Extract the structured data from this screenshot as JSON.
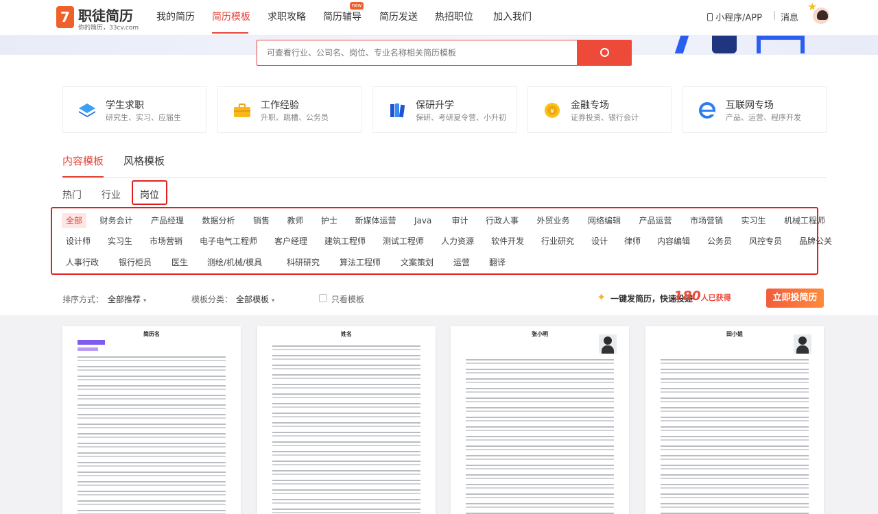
{
  "header": {
    "logo_mark": "7",
    "logo_name": "职徒简历",
    "logo_sub": "你的简历，33cv.com",
    "nav": [
      {
        "label": "我的简历",
        "active": false
      },
      {
        "label": "简历模板",
        "active": true
      },
      {
        "label": "求职攻略",
        "active": false
      },
      {
        "label": "简历辅导",
        "active": false,
        "badge": "new"
      },
      {
        "label": "简历发送",
        "active": false
      },
      {
        "label": "热招职位",
        "active": false
      },
      {
        "label": "加入我们",
        "active": false
      }
    ],
    "mini_app": "小程序/APP",
    "separator": "|",
    "messages": "消息"
  },
  "search": {
    "placeholder": "可查看行业、公司名、岗位、专业名称相关简历模板"
  },
  "categories": [
    {
      "title": "学生求职",
      "subtitle": "研究生、实习、应届生",
      "icon": "layers-icon"
    },
    {
      "title": "工作经验",
      "subtitle": "升职、跳槽、公务员",
      "icon": "briefcase-icon"
    },
    {
      "title": "保研升学",
      "subtitle": "保研、考研夏令营、小升初",
      "icon": "books-icon"
    },
    {
      "title": "金融专场",
      "subtitle": "证券投资、银行会计",
      "icon": "coin-icon"
    },
    {
      "title": "互联网专场",
      "subtitle": "产品、运营、程序开发",
      "icon": "browser-icon"
    }
  ],
  "template_tabs": [
    {
      "label": "内容模板",
      "active": true
    },
    {
      "label": "风格模板",
      "active": false
    }
  ],
  "sub_tabs": [
    {
      "label": "热门",
      "active": false
    },
    {
      "label": "行业",
      "active": false
    },
    {
      "label": "岗位",
      "active": true
    }
  ],
  "positions": [
    [
      "全部",
      "财务会计",
      "产品经理",
      "数据分析",
      "销售",
      "教师",
      "护士",
      "新媒体运营",
      "Java",
      "审计",
      "行政人事",
      "外贸业务",
      "网络编辑",
      "产品运营",
      "市场营销",
      "实习生",
      "机械工程师"
    ],
    [
      "设计师",
      "实习生",
      "市场营销",
      "电子电气工程师",
      "客户经理",
      "建筑工程师",
      "测试工程师",
      "人力资源",
      "软件开发",
      "行业研究",
      "设计",
      "律师",
      "内容编辑",
      "公务员",
      "风控专员",
      "品牌公关"
    ],
    [
      "人事行政",
      "银行柜员",
      "医生",
      "测绘/机械/模具",
      "科研研究",
      "算法工程师",
      "文案策划",
      "运营",
      "翻译"
    ]
  ],
  "sort_bar": {
    "sort_label": "排序方式：",
    "sort_value": "全部推荐",
    "filter_label": "模板分类：",
    "filter_value": "全部模板",
    "checkbox_label": "只看模板",
    "promo_text": "一键发简历，快速投递",
    "promo_number": "180",
    "promo_suffix": "人已获得",
    "promo_button": "立即投简历"
  },
  "templates": [
    {
      "name": "简历名",
      "photo": false,
      "accent": true
    },
    {
      "name": "姓名",
      "photo": false,
      "accent": false
    },
    {
      "name": "张小明",
      "photo": true,
      "accent": false
    },
    {
      "name": "田小姐",
      "photo": true,
      "accent": false
    }
  ],
  "colors": {
    "accent": "#e8433a",
    "highlight_box": "#e02020",
    "search_button": "#ed4a3a"
  }
}
